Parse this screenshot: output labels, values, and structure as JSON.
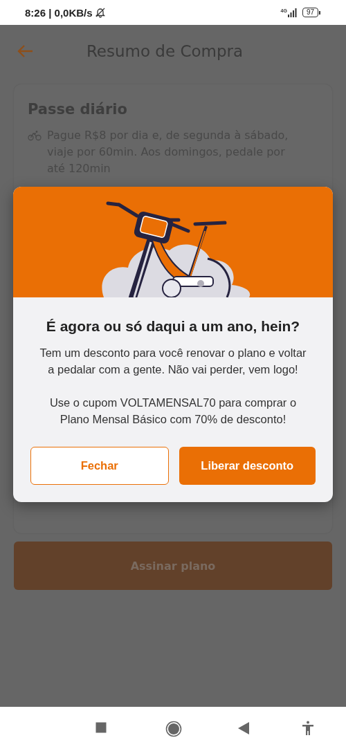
{
  "status_bar": {
    "time_and_speed": "8:26 | 0,0KB/s",
    "network": "4G",
    "battery": "97"
  },
  "header": {
    "title": "Resumo de Compra"
  },
  "plan_card": {
    "title": "Passe diário",
    "description": "Pague R$8 por dia e, de segunda à sábado, viaje por 60min. Aos domingos, pedale por até 120min"
  },
  "subscribe_button": {
    "label": "Assinar plano",
    "disabled": true
  },
  "dialog": {
    "title": "É agora ou só daqui a um ano, hein?",
    "paragraphs": [
      "Tem um desconto para você renovar o plano e voltar a pedalar com a gente. Não vai perder, vem logo!",
      "Use o cupom VOLTAMENSAL70 para comprar o Plano Mensal Básico com 70% de desconto!"
    ],
    "buttons": [
      {
        "label": "Fechar",
        "kind": "outline"
      },
      {
        "label": "Liberar desconto",
        "kind": "primary"
      }
    ]
  }
}
